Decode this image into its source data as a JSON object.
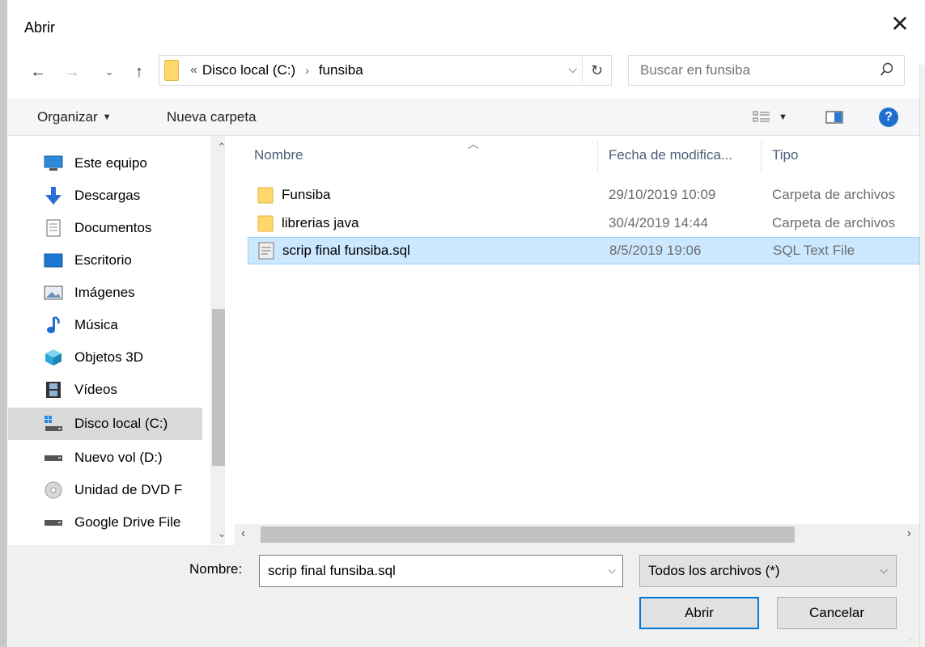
{
  "window": {
    "title": "Abrir"
  },
  "nav": {
    "breadcrumb_overflow": "«",
    "breadcrumbs": [
      "Disco local (C:)",
      "funsiba"
    ],
    "search_placeholder": "Buscar en funsiba"
  },
  "toolbar": {
    "organize_label": "Organizar",
    "new_folder_label": "Nueva carpeta"
  },
  "sidebar": {
    "items": [
      {
        "label": "Este equipo",
        "icon": "computer-icon"
      },
      {
        "label": "Descargas",
        "icon": "download-arrow-icon"
      },
      {
        "label": "Documentos",
        "icon": "documents-icon"
      },
      {
        "label": "Escritorio",
        "icon": "desktop-icon"
      },
      {
        "label": "Imágenes",
        "icon": "pictures-icon"
      },
      {
        "label": "Música",
        "icon": "music-note-icon"
      },
      {
        "label": "Objetos 3D",
        "icon": "cube-3d-icon"
      },
      {
        "label": "Vídeos",
        "icon": "film-icon"
      },
      {
        "label": "Disco local (C:)",
        "icon": "windows-drive-icon",
        "selected": true
      },
      {
        "label": "Nuevo vol (D:)",
        "icon": "drive-icon"
      },
      {
        "label": "Unidad de DVD F",
        "icon": "dvd-icon"
      },
      {
        "label": "Google Drive File",
        "icon": "drive-icon"
      }
    ]
  },
  "filelist": {
    "columns": [
      "Nombre",
      "Fecha de modifica...",
      "Tipo"
    ],
    "rows": [
      {
        "name": "Funsiba",
        "date": "29/10/2019 10:09",
        "type": "Carpeta de archivos",
        "icon": "folder-icon"
      },
      {
        "name": "librerias java",
        "date": "30/4/2019 14:44",
        "type": "Carpeta de archivos",
        "icon": "folder-icon"
      },
      {
        "name": "scrip final funsiba.sql",
        "date": "8/5/2019 19:06",
        "type": "SQL Text File",
        "icon": "sql-file-icon",
        "selected": true
      }
    ]
  },
  "footer": {
    "filename_label": "Nombre:",
    "filename_value": "scrip final funsiba.sql",
    "filetype_value": "Todos los archivos (*)",
    "open_label": "Abrir",
    "cancel_label": "Cancelar"
  },
  "colors": {
    "selection_bg": "#cce8ff",
    "selection_border": "#99d1ff",
    "folder_yellow": "#ffd76a",
    "accent_blue": "#0078d7",
    "header_text": "#4c607a"
  }
}
